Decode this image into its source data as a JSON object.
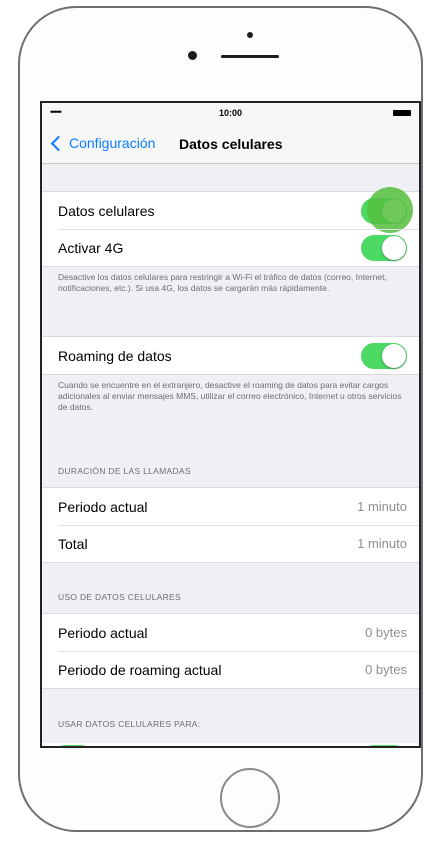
{
  "status_bar": {
    "signal": "•••••",
    "time": "10:00"
  },
  "nav": {
    "back_label": "Configuración",
    "title": "Datos celulares"
  },
  "group1": {
    "row1": {
      "label": "Datos celulares",
      "toggle_on": true
    },
    "row2": {
      "label": "Activar 4G",
      "toggle_on": true
    }
  },
  "footnote1": "Desactive los datos celulares para restringir a Wi-Fi el tráfico de datos (correo, Internet, notificaciones, etc.). Si usa 4G, los datos se cargarán más rápidamente.",
  "group2": {
    "row1": {
      "label": "Roaming de datos",
      "toggle_on": true
    }
  },
  "footnote2": "Cuando se encuentre en el extranjero, desactive el roaming de datos para evitar cargos adicionales al enviar mensajes MMS, utilizar el correo electrónico, Internet u otros servicios de datos.",
  "section_calls": {
    "header": "DURACIÓN DE LAS LLAMADAS",
    "rows": [
      {
        "label": "Periodo actual",
        "value": "1 minuto"
      },
      {
        "label": "Total",
        "value": "1 minuto"
      }
    ]
  },
  "section_usage": {
    "header": "USO DE DATOS CELULARES",
    "rows": [
      {
        "label": "Periodo actual",
        "value": "0 bytes"
      },
      {
        "label": "Periodo de roaming actual",
        "value": "0 bytes"
      }
    ]
  },
  "section_apps": {
    "header": "USAR DATOS CELULARES PARA:"
  },
  "colors": {
    "accent_blue": "#0a7cff",
    "toggle_green": "#4cd964",
    "background": "#efeff4"
  }
}
